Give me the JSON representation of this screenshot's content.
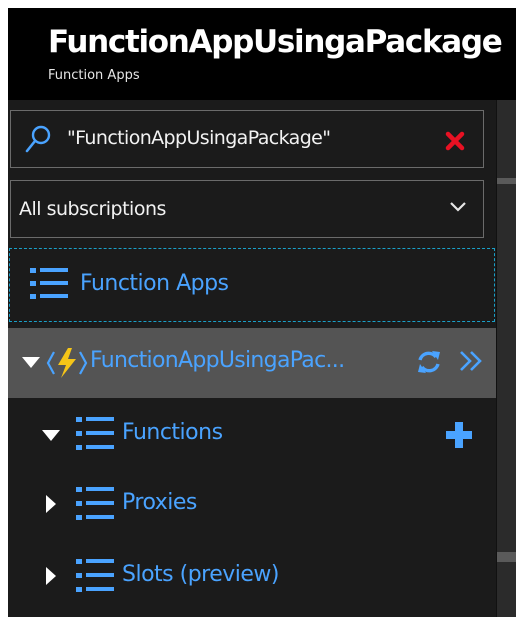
{
  "header": {
    "title": "FunctionAppUsingaPackage",
    "subtitle": "Function Apps"
  },
  "search": {
    "value": "\"FunctionAppUsingaPackage\"",
    "icon": "search-icon",
    "clear_icon": "close-icon"
  },
  "subscriptions": {
    "selected": "All subscriptions",
    "icon": "chevron-down-icon"
  },
  "tree": {
    "root_label": "Function Apps",
    "app_label": "FunctionAppUsingaPac...",
    "items": [
      {
        "label": "Functions",
        "expanded": true
      },
      {
        "label": "Proxies",
        "expanded": false
      },
      {
        "label": "Slots (preview)",
        "expanded": false
      }
    ]
  },
  "colors": {
    "accent": "#4aa3ff",
    "selected_row": "#545454",
    "focus_outline": "#1aa0c8",
    "clear_red": "#e81123",
    "bolt": "#f5c518"
  }
}
